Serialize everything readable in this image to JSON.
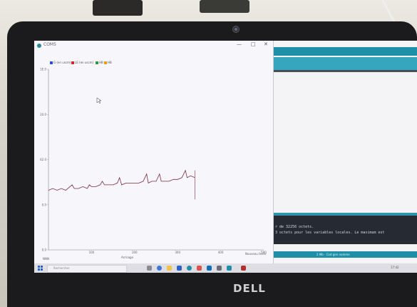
{
  "window": {
    "title": "COM5",
    "buttons": {
      "minimize": "—",
      "maximize": "□",
      "close": "✕"
    }
  },
  "legend": [
    {
      "label": "G (en uscm)",
      "color": "#2b4fc9"
    },
    {
      "label": "LE (en uscm)",
      "color": "#cc2a2a"
    },
    {
      "label": "HB",
      "color": "#2a9a3f"
    },
    {
      "label": "HB",
      "color": "#e0a020"
    }
  ],
  "chart_data": {
    "type": "line",
    "y_ticks": [
      "1E.0",
      "20.0",
      "62.0",
      "0.0",
      "0.0"
    ],
    "x_ticks": [
      "100",
      "200",
      "300",
      "400",
      "500"
    ],
    "ylim": [
      0,
      100
    ],
    "xlim": [
      0,
      500
    ],
    "series": [
      {
        "color": "#7a2b3a",
        "x": [
          0,
          10,
          20,
          30,
          40,
          50,
          55,
          60,
          70,
          80,
          90,
          95,
          100,
          110,
          120,
          125,
          130,
          140,
          150,
          160,
          165,
          170,
          180,
          190,
          200,
          210,
          220,
          228,
          232,
          240,
          250,
          258,
          262,
          270,
          280,
          290,
          300,
          310,
          318,
          322,
          330,
          340
        ],
        "y": [
          33,
          34,
          33,
          34,
          33,
          35,
          36,
          34,
          34,
          35,
          34,
          36,
          35,
          35,
          36,
          38,
          36,
          36,
          36,
          37,
          40,
          36,
          37,
          37,
          37,
          37,
          38,
          42,
          37,
          38,
          38,
          42,
          38,
          38,
          38,
          39,
          39,
          40,
          44,
          40,
          41,
          40
        ]
      }
    ]
  },
  "bottom_bar": {
    "left": "NNN",
    "middle": "Arrinage",
    "right": "Nouveau texte"
  },
  "console": {
    "lines": [
      "r de 32256 octets.",
      "3 octets pour les variables locales. Le maximum est"
    ]
  },
  "status": {
    "text": "2 Mb · Cod gen nomme"
  },
  "taskbar": {
    "search_placeholder": "Rechercher",
    "tray_time": "17:42"
  },
  "brand": "DELL"
}
